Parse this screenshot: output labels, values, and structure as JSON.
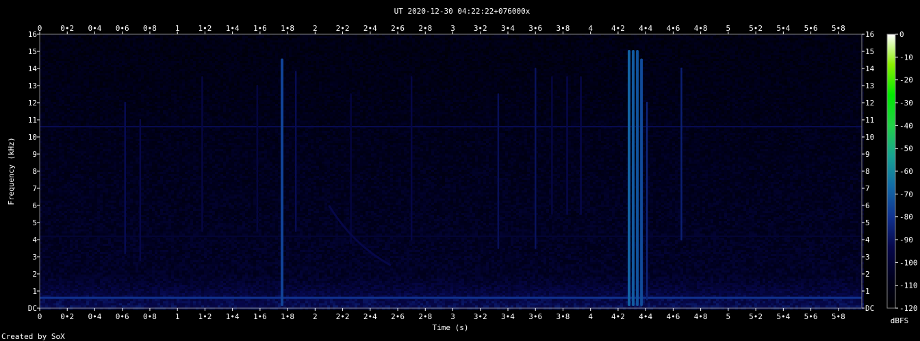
{
  "chart_data": {
    "type": "heatmap",
    "title": "UT 2020-12-30 04:22:22+076000x",
    "xlabel": "Time (s)",
    "ylabel": "Frequency (kHz)",
    "xlim": [
      0,
      5.97
    ],
    "ylim": [
      0,
      16
    ],
    "x_ticks": [
      "0",
      "0•2",
      "0•4",
      "0•6",
      "0•8",
      "1",
      "1•2",
      "1•4",
      "1•6",
      "1•8",
      "2",
      "2•2",
      "2•4",
      "2•6",
      "2•8",
      "3",
      "3•2",
      "3•4",
      "3•6",
      "3•8",
      "4",
      "4•2",
      "4•4",
      "4•6",
      "4•8",
      "5",
      "5•2",
      "5•4",
      "5•6",
      "5•8"
    ],
    "y_ticks": [
      "DC",
      "1",
      "2",
      "3",
      "4",
      "5",
      "6",
      "7",
      "8",
      "9",
      "10",
      "11",
      "12",
      "13",
      "14",
      "15",
      "16"
    ],
    "colorbar": {
      "label": "dBFS",
      "ticks": [
        "0",
        "-10",
        "-20",
        "-30",
        "-40",
        "-50",
        "-60",
        "-70",
        "-80",
        "-90",
        "-100",
        "-110",
        "-120"
      ],
      "range": [
        -120,
        0
      ],
      "colors": [
        "#000000",
        "#00001e",
        "#06074a",
        "#103290",
        "#126aa6",
        "#17a392",
        "#22d048",
        "#00e800",
        "#8af000",
        "#ffffff"
      ]
    },
    "features": {
      "hum_lines_khz": [
        0.6,
        10.6,
        4.2
      ],
      "transients": [
        {
          "t": 0.62,
          "f_low": 3.2,
          "f_high": 12.0,
          "dbfs": -92
        },
        {
          "t": 0.73,
          "f_low": 2.8,
          "f_high": 11.0,
          "dbfs": -94
        },
        {
          "t": 1.18,
          "f_low": 4.5,
          "f_high": 13.5,
          "dbfs": -96
        },
        {
          "t": 1.58,
          "f_low": 4.5,
          "f_high": 13.0,
          "dbfs": -97
        },
        {
          "t": 1.76,
          "f_low": 0.2,
          "f_high": 14.5,
          "dbfs": -76
        },
        {
          "t": 1.86,
          "f_low": 4.5,
          "f_high": 13.8,
          "dbfs": -92
        },
        {
          "t": 2.26,
          "f_low": 3.8,
          "f_high": 12.5,
          "dbfs": -97
        },
        {
          "t": 2.7,
          "f_low": 4.0,
          "f_high": 13.5,
          "dbfs": -95
        },
        {
          "t": 3.33,
          "f_low": 3.5,
          "f_high": 12.5,
          "dbfs": -91
        },
        {
          "t": 3.6,
          "f_low": 3.5,
          "f_high": 14.0,
          "dbfs": -90
        },
        {
          "t": 3.72,
          "f_low": 5.5,
          "f_high": 13.5,
          "dbfs": -96
        },
        {
          "t": 3.83,
          "f_low": 5.5,
          "f_high": 13.5,
          "dbfs": -94
        },
        {
          "t": 3.93,
          "f_low": 5.5,
          "f_high": 13.5,
          "dbfs": -94
        },
        {
          "t": 4.28,
          "f_low": 0.2,
          "f_high": 15.0,
          "dbfs": -68
        },
        {
          "t": 4.31,
          "f_low": 0.2,
          "f_high": 15.0,
          "dbfs": -70
        },
        {
          "t": 4.34,
          "f_low": 0.2,
          "f_high": 15.0,
          "dbfs": -72
        },
        {
          "t": 4.37,
          "f_low": 0.2,
          "f_high": 14.5,
          "dbfs": -74
        },
        {
          "t": 4.41,
          "f_low": 0.5,
          "f_high": 12.0,
          "dbfs": -85
        },
        {
          "t": 4.66,
          "f_low": 4.0,
          "f_high": 14.0,
          "dbfs": -86
        }
      ],
      "sweep": {
        "t_start": 2.1,
        "f_start": 6.0,
        "t_end": 2.55,
        "f_end": 2.5,
        "dbfs": -94
      }
    }
  },
  "footer": {
    "credit": "Created by SoX"
  }
}
